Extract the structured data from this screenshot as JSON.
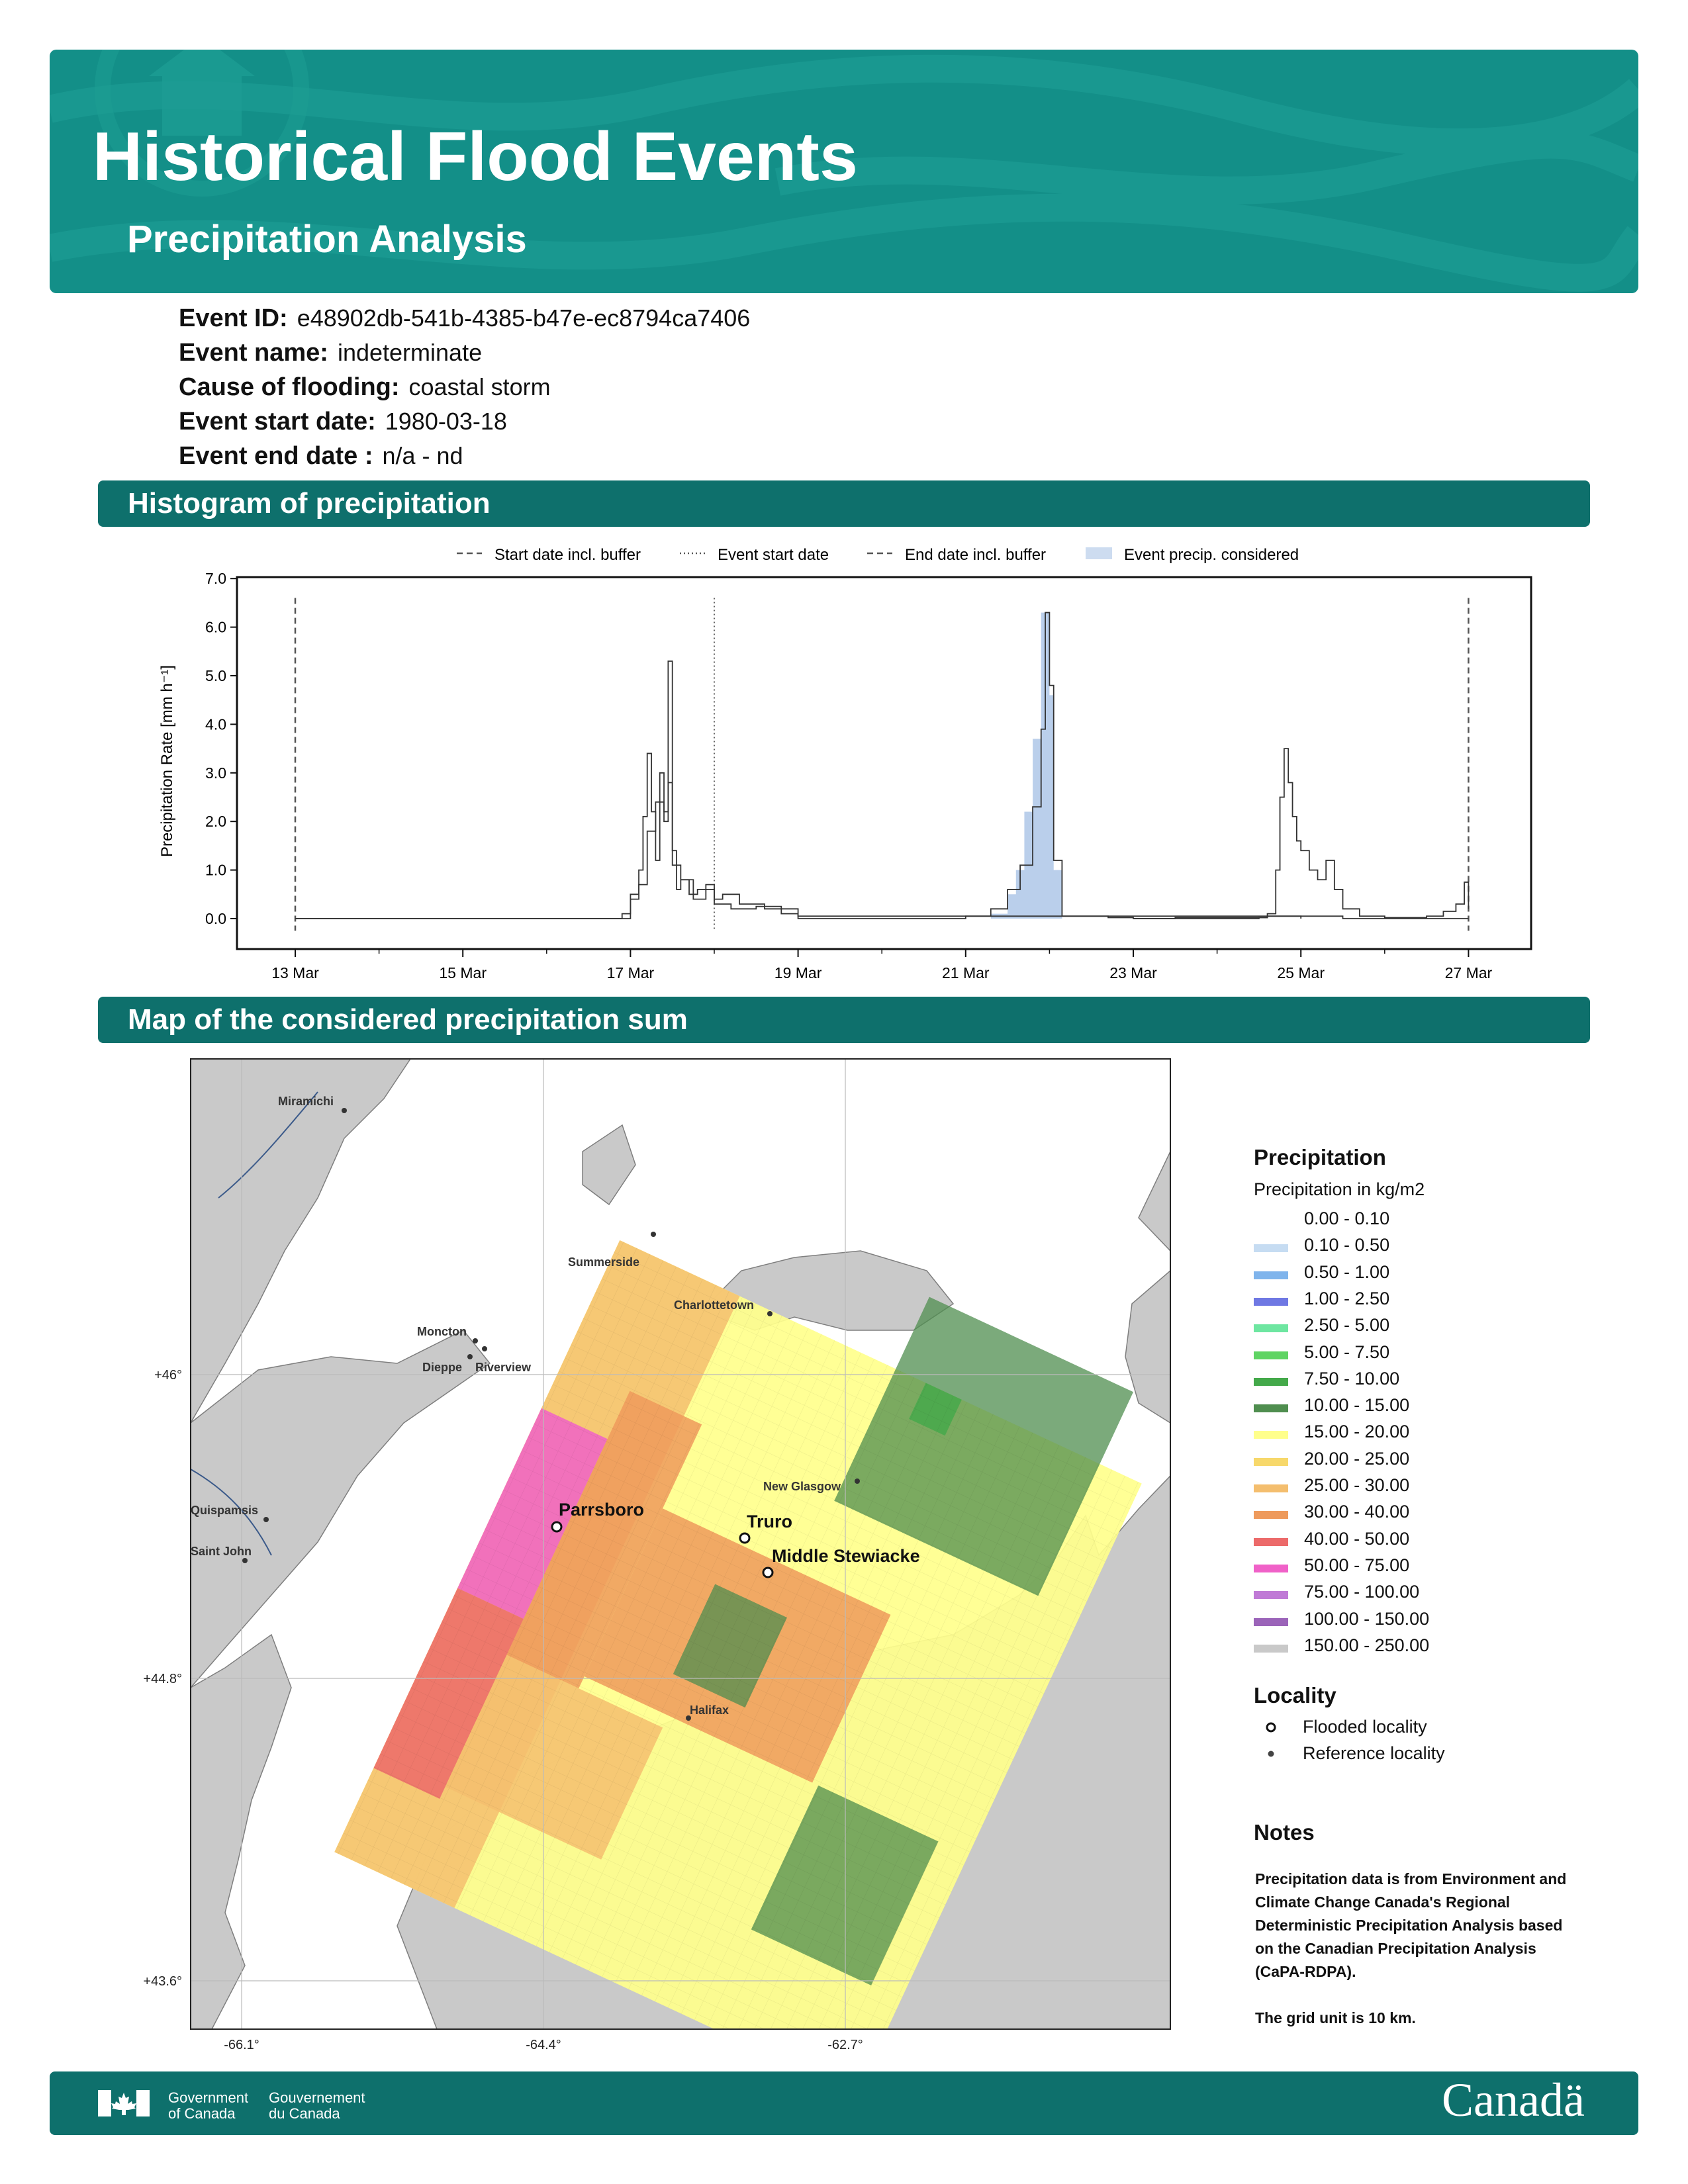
{
  "header": {
    "title": "Historical Flood Events",
    "subtitle": "Precipitation Analysis",
    "bg_color": "#138f88"
  },
  "event": [
    {
      "label": "Event ID:",
      "value": "e48902db-541b-4385-b47e-ec8794ca7406"
    },
    {
      "label": "Event name:",
      "value": "indeterminate"
    },
    {
      "label": "Cause of flooding:",
      "value": "coastal storm"
    },
    {
      "label": "Event start date:",
      "value": "1980-03-18"
    },
    {
      "label": "Event end date :",
      "value": "n/a - nd"
    }
  ],
  "sections": {
    "histogram": "Histogram of precipitation",
    "map": "Map of the considered precipitation sum"
  },
  "chart_data": {
    "type": "line",
    "ylabel": "Precipitation Rate [mm h⁻¹]",
    "xlabel": "",
    "ylim": [
      0,
      7
    ],
    "yticks": [
      "0.0",
      "1.0",
      "2.0",
      "3.0",
      "4.0",
      "5.0",
      "6.0",
      "7.0"
    ],
    "xticks": [
      "13 Mar",
      "15 Mar",
      "17 Mar",
      "19 Mar",
      "21 Mar",
      "23 Mar",
      "25 Mar",
      "27 Mar"
    ],
    "x_unit": "days after 13 Mar 00:00",
    "legend": [
      {
        "label": "Start date incl. buffer",
        "style": "dashed"
      },
      {
        "label": "Event start date",
        "style": "dotted"
      },
      {
        "label": "End date incl. buffer",
        "style": "dashed"
      },
      {
        "label": "Event precip. considered",
        "style": "fill"
      }
    ],
    "legend_position": "top-center",
    "markers": {
      "start_buffer": "13 Mar",
      "event_start": "18 Mar",
      "end_buffer": "27 Mar"
    },
    "series": [
      {
        "name": "series-a",
        "points": [
          [
            0,
            0
          ],
          [
            3.8,
            0
          ],
          [
            3.9,
            0.1
          ],
          [
            4.0,
            0.5
          ],
          [
            4.1,
            1.0
          ],
          [
            4.15,
            2.1
          ],
          [
            4.2,
            3.4
          ],
          [
            4.25,
            2.2
          ],
          [
            4.3,
            1.2
          ],
          [
            4.35,
            3.0
          ],
          [
            4.4,
            2.0
          ],
          [
            4.45,
            5.3
          ],
          [
            4.5,
            1.4
          ],
          [
            4.55,
            0.6
          ],
          [
            4.6,
            0.8
          ],
          [
            4.7,
            0.5
          ],
          [
            4.8,
            0.6
          ],
          [
            4.9,
            0.7
          ],
          [
            5.0,
            0.4
          ],
          [
            5.1,
            0.5
          ],
          [
            5.3,
            0.3
          ],
          [
            5.6,
            0.2
          ],
          [
            6.0,
            0.05
          ],
          [
            12.0,
            0
          ]
        ]
      },
      {
        "name": "series-b",
        "points": [
          [
            0,
            0
          ],
          [
            3.85,
            0
          ],
          [
            4.0,
            0.4
          ],
          [
            4.1,
            0.7
          ],
          [
            4.2,
            1.8
          ],
          [
            4.3,
            2.4
          ],
          [
            4.4,
            2.2
          ],
          [
            4.45,
            2.8
          ],
          [
            4.5,
            1.1
          ],
          [
            4.6,
            0.8
          ],
          [
            4.75,
            0.4
          ],
          [
            4.9,
            0.6
          ],
          [
            5.0,
            0.3
          ],
          [
            5.2,
            0.2
          ],
          [
            5.5,
            0.25
          ],
          [
            5.8,
            0.1
          ],
          [
            6.0,
            0
          ],
          [
            7.7,
            0
          ],
          [
            8.0,
            0.05
          ],
          [
            8.3,
            0.2
          ],
          [
            8.5,
            0.6
          ],
          [
            8.65,
            1.1
          ],
          [
            8.8,
            2.3
          ],
          [
            8.9,
            3.9
          ],
          [
            8.95,
            6.3
          ],
          [
            9.0,
            4.8
          ],
          [
            9.05,
            1.2
          ],
          [
            9.15,
            0.05
          ],
          [
            9.7,
            0.02
          ],
          [
            10.0,
            0
          ],
          [
            10.5,
            0.02
          ],
          [
            11.6,
            0.05
          ],
          [
            12.5,
            0
          ],
          [
            14.0,
            0
          ]
        ]
      },
      {
        "name": "series-c",
        "points": [
          [
            10.0,
            0
          ],
          [
            11.5,
            0.02
          ],
          [
            11.6,
            0.1
          ],
          [
            11.7,
            1.0
          ],
          [
            11.75,
            2.5
          ],
          [
            11.8,
            3.5
          ],
          [
            11.85,
            2.8
          ],
          [
            11.9,
            2.1
          ],
          [
            11.95,
            1.6
          ],
          [
            12.0,
            1.4
          ],
          [
            12.1,
            1.0
          ],
          [
            12.2,
            0.8
          ],
          [
            12.3,
            1.2
          ],
          [
            12.4,
            0.6
          ],
          [
            12.5,
            0.2
          ],
          [
            12.7,
            0.05
          ],
          [
            13.0,
            0.02
          ],
          [
            13.5,
            0.05
          ],
          [
            13.7,
            0.15
          ],
          [
            13.85,
            0.3
          ],
          [
            13.95,
            0.75
          ],
          [
            14.0,
            0.2
          ]
        ]
      }
    ],
    "event_fill": {
      "color": "#a9c3e6",
      "points": [
        [
          7.9,
          0
        ],
        [
          8.3,
          0.1
        ],
        [
          8.5,
          0.5
        ],
        [
          8.6,
          1.0
        ],
        [
          8.7,
          2.2
        ],
        [
          8.8,
          3.7
        ],
        [
          8.9,
          6.3
        ],
        [
          9.0,
          4.6
        ],
        [
          9.05,
          1.0
        ],
        [
          9.15,
          0
        ]
      ]
    }
  },
  "map": {
    "legend_title": "Precipitation",
    "legend_subtitle": "Precipitation in kg/m2",
    "classes": [
      {
        "label": "0.00 - 0.10",
        "color": "#ffffff"
      },
      {
        "label": "0.10 - 0.50",
        "color": "#c6dcf2"
      },
      {
        "label": "0.50 - 1.00",
        "color": "#7fb4ec"
      },
      {
        "label": "1.00 - 2.50",
        "color": "#6f78e3"
      },
      {
        "label": "2.50 - 5.00",
        "color": "#6ee6a1"
      },
      {
        "label": "5.00 - 7.50",
        "color": "#5fd463"
      },
      {
        "label": "7.50 - 10.00",
        "color": "#44a94a"
      },
      {
        "label": "10.00 - 15.00",
        "color": "#4f8e4f"
      },
      {
        "label": "15.00 - 20.00",
        "color": "#ffff8c"
      },
      {
        "label": "20.00 - 25.00",
        "color": "#f7d86b"
      },
      {
        "label": "25.00 - 30.00",
        "color": "#f4be6e"
      },
      {
        "label": "30.00 - 40.00",
        "color": "#ee9a5c"
      },
      {
        "label": "40.00 - 50.00",
        "color": "#ec6a6a"
      },
      {
        "label": "50.00 - 75.00",
        "color": "#f061c8"
      },
      {
        "label": "75.00 - 100.00",
        "color": "#c07ad6"
      },
      {
        "label": "100.00 - 150.00",
        "color": "#9b64b9"
      },
      {
        "label": "150.00 - 250.00",
        "color": "#c9c9c9"
      }
    ],
    "locality_title": "Locality",
    "locality_items": [
      "Flooded locality",
      "Reference locality"
    ],
    "notes_title": "Notes",
    "notes": [
      "Precipitation data is from Environment and",
      "Climate Change Canada's Regional",
      "Deterministic Precipitation Analysis based",
      "on the Canadian Precipitation Analysis",
      "(CaPA-RDPA).",
      "",
      "The grid unit is 10 km."
    ],
    "lat_ticks": [
      "+46°",
      "+44.8°",
      "+43.6°"
    ],
    "lon_ticks": [
      "-66.1°",
      "-64.4°",
      "-62.7°"
    ],
    "flooded": [
      "Parrsboro",
      "Truro",
      "Middle Stewiacke"
    ],
    "reference": [
      "Miramichi",
      "Summerside",
      "Charlottetown",
      "Moncton",
      "Dieppe",
      "Riverview",
      "New Glasgow",
      "Quispamsis",
      "Saint John",
      "Halifax"
    ]
  },
  "footer": {
    "gov_en": [
      "Government",
      "of Canada"
    ],
    "gov_fr": [
      "Gouvernement",
      "du Canada"
    ],
    "wordmark": "Canadä"
  }
}
